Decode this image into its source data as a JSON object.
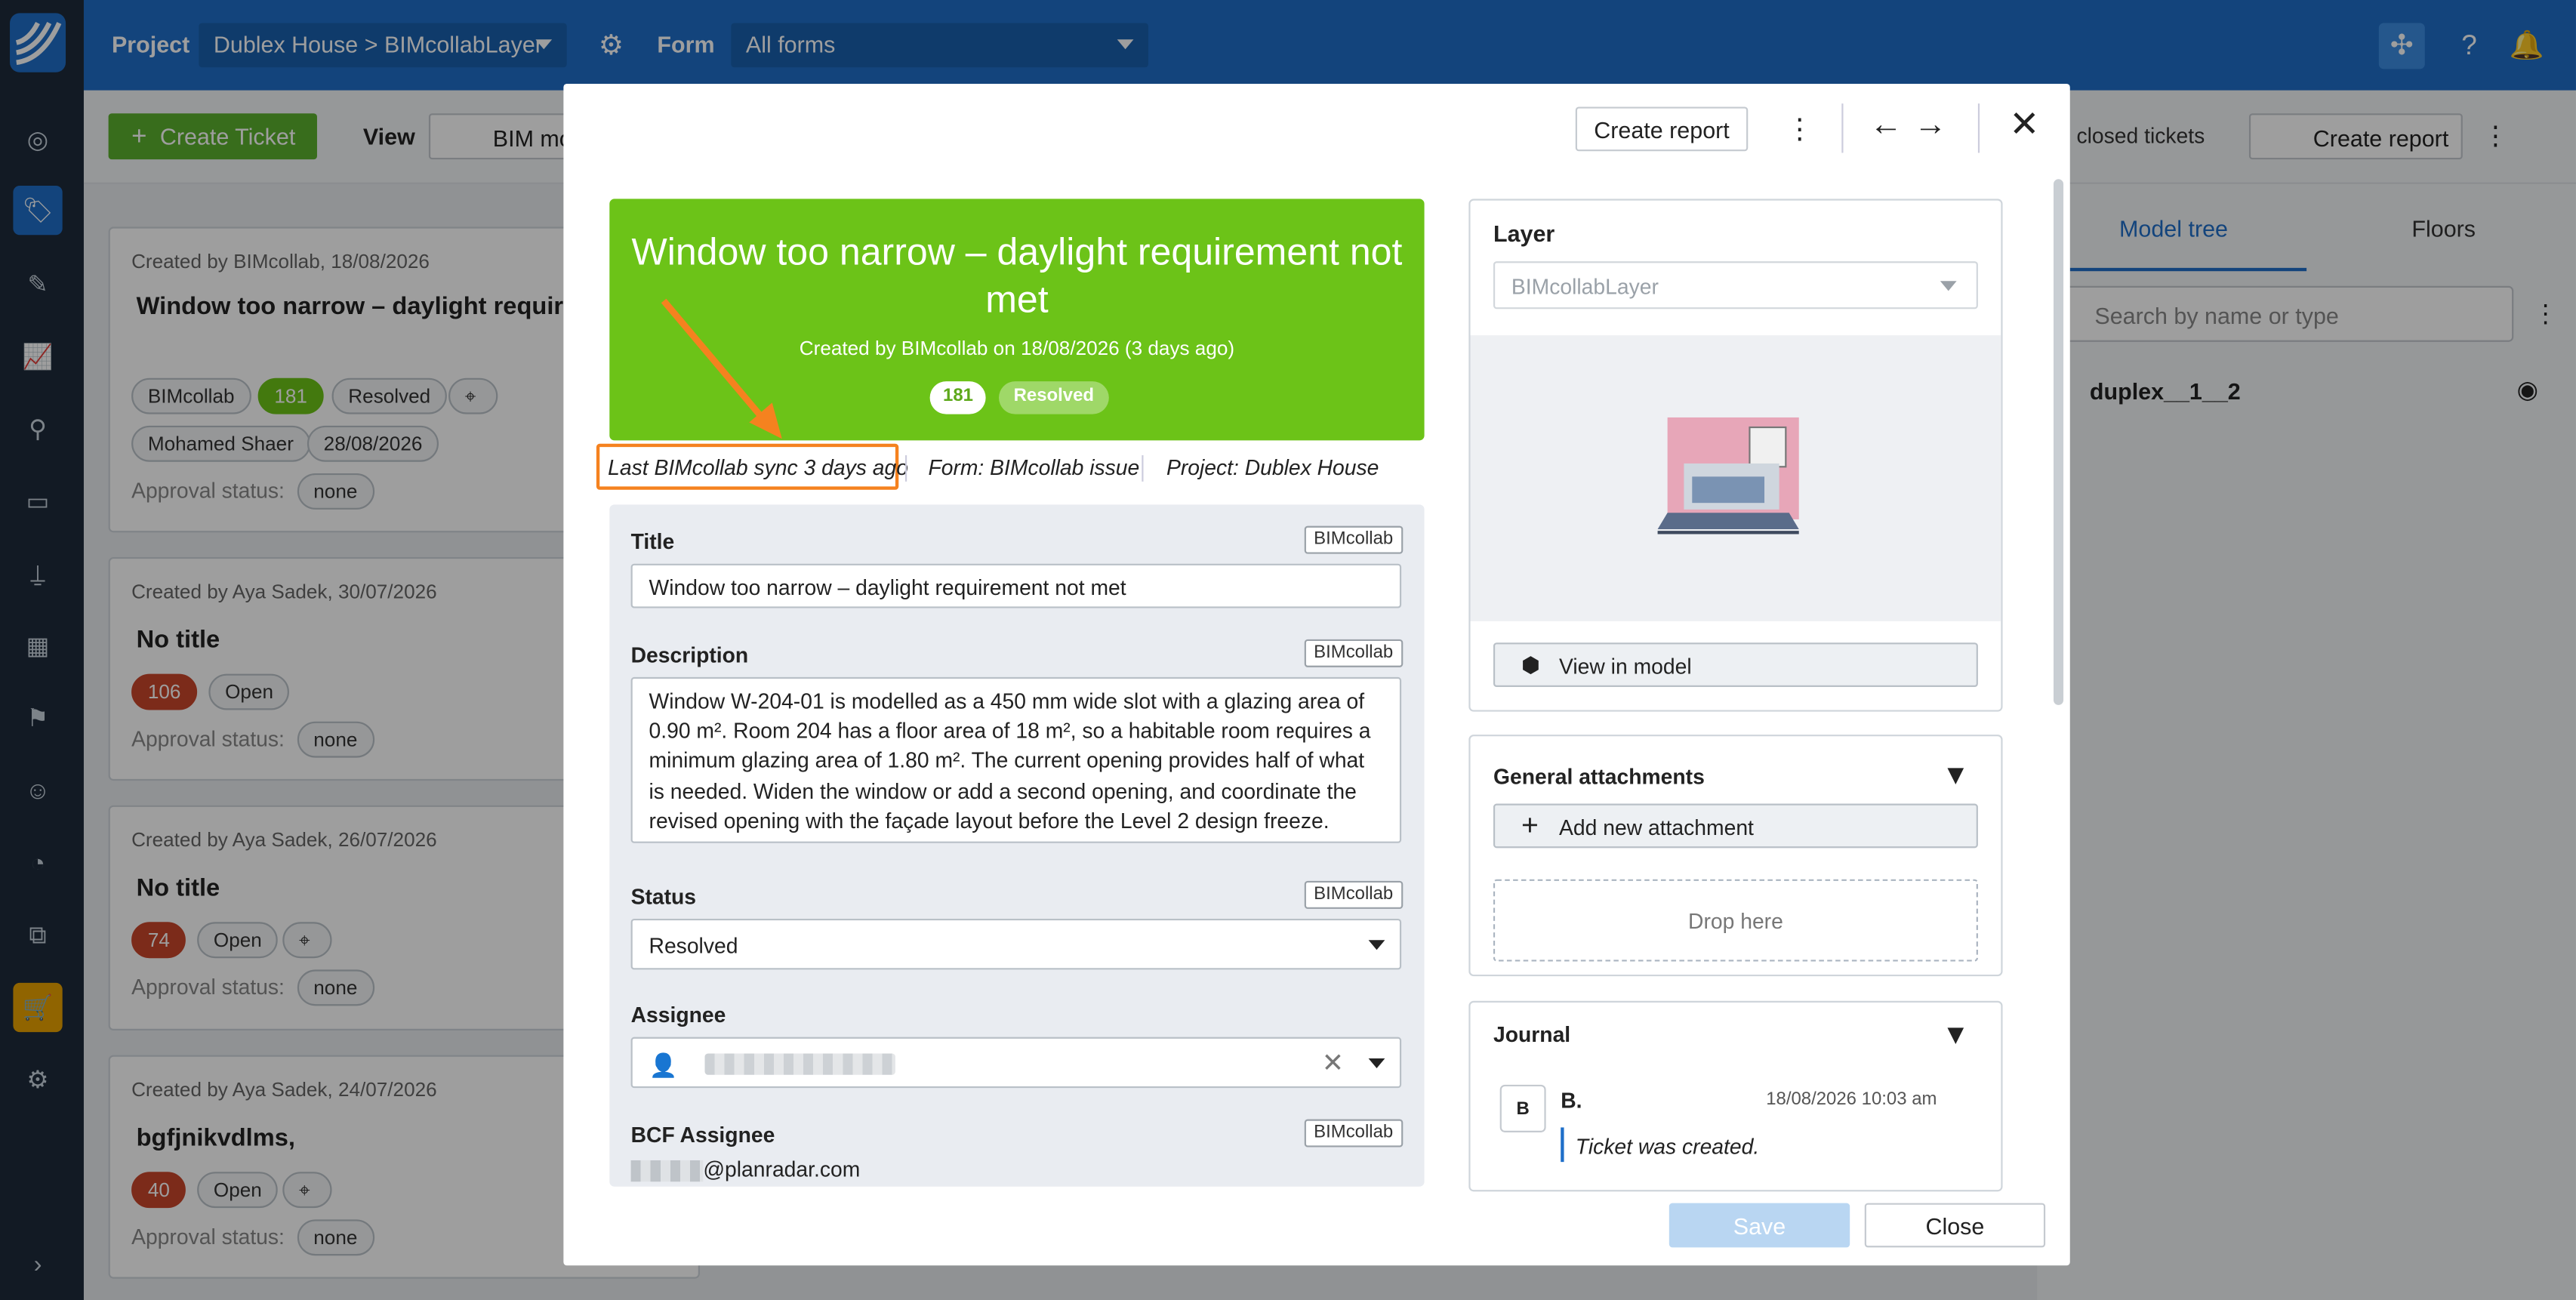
{
  "topbar": {
    "project_label": "Project",
    "project_value": "Dublex House > BIMcollabLayer",
    "form_label": "Form",
    "form_value": "All forms"
  },
  "toolbar": {
    "create_ticket": "Create Ticket",
    "view_label": "View",
    "view_value": "BIM mo",
    "closed_tickets": "closed tickets",
    "create_report": "Create report"
  },
  "tickets": [
    {
      "meta": "Created by BIMcollab, 18/08/2026",
      "title": "Window too narrow – daylight requiremen met",
      "chips": [
        "BIMcollab",
        "181",
        "Resolved"
      ],
      "chips2": [
        "Mohamed Shaer",
        "28/08/2026"
      ],
      "approval_label": "Approval status:",
      "approval_value": "none"
    },
    {
      "meta": "Created by Aya Sadek, 30/07/2026",
      "title": "No title",
      "chips": [
        "106",
        "Open"
      ],
      "approval_label": "Approval status:",
      "approval_value": "none"
    },
    {
      "meta": "Created by Aya Sadek, 26/07/2026",
      "title": "No title",
      "chips": [
        "74",
        "Open"
      ],
      "approval_label": "Approval status:",
      "approval_value": "none"
    },
    {
      "meta": "Created by Aya Sadek, 24/07/2026",
      "title": "bgfjnikvdlms,",
      "chips": [
        "40",
        "Open"
      ],
      "approval_label": "Approval status:",
      "approval_value": "none"
    }
  ],
  "right_panel": {
    "tab_model_tree": "Model tree",
    "tab_floors": "Floors",
    "search_placeholder": "Search by name or type",
    "tree_item": "duplex__1__2"
  },
  "modal": {
    "create_report": "Create report",
    "ticket_title": "Window too narrow – daylight requirement not met",
    "created_by": "Created by BIMcollab on 18/08/2026 (3 days ago)",
    "ticket_number": "181",
    "ticket_status": "Resolved",
    "sync_info": "Last BIMcollab sync 3 days ago",
    "form_info": "Form: BIMcollab issue",
    "project_info": "Project: Dublex House",
    "source_tag": "BIMcollab",
    "fields": {
      "title_label": "Title",
      "title_value": "Window too narrow – daylight requirement not met",
      "description_label": "Description",
      "description_value": "Window W-204-01 is modelled as a 450 mm wide slot with a glazing area of 0.90 m². Room 204 has a floor area of 18 m², so a habitable room requires a minimum glazing area of 1.80 m². The current opening provides half of what is needed. Widen the window or add a second opening, and coordinate the revised opening with the façade layout before the Level 2 design freeze.",
      "status_label": "Status",
      "status_value": "Resolved",
      "assignee_label": "Assignee",
      "bcf_assignee_label": "BCF Assignee",
      "bcf_assignee_value": "@planradar.com"
    },
    "layer": {
      "label": "Layer",
      "value": "BIMcollabLayer",
      "view_in_model": "View in model"
    },
    "attachments": {
      "label": "General attachments",
      "add_new": "Add new attachment",
      "drop_here": "Drop here"
    },
    "journal": {
      "label": "Journal",
      "avatar_letter": "B",
      "author": "B.",
      "timestamp": "18/08/2026 10:03 am",
      "entry": "Ticket was created."
    },
    "save": "Save",
    "close": "Close"
  },
  "colors": {
    "brand_blue": "#1f6fc9",
    "resolved_green": "#6cc318",
    "open_red": "#c8462b",
    "highlight_orange": "#f5821f"
  }
}
